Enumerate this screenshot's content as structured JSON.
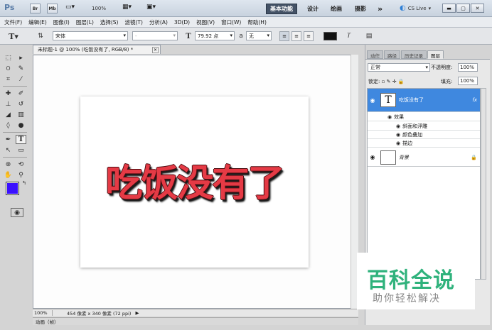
{
  "app": {
    "logo": "Ps",
    "br_label": "Br",
    "mb_label": "Mb"
  },
  "titlebar": {
    "zoom": "100%",
    "workspaces": [
      "基本功能",
      "设计",
      "绘画",
      "摄影"
    ],
    "more": "»",
    "cslive": "CS Live"
  },
  "menu": [
    "文件(F)",
    "编辑(E)",
    "图像(I)",
    "图层(L)",
    "选择(S)",
    "滤镜(T)",
    "分析(A)",
    "3D(D)",
    "视图(V)",
    "窗口(W)",
    "帮助(H)"
  ],
  "options": {
    "font_family": "宋体",
    "font_style": "-",
    "font_size": "79.92 点",
    "aa_label": "a",
    "aa_value": "无"
  },
  "document": {
    "tab_title": "未标题-1 @ 100% (吃饭没有了, RGB/8) *",
    "canvas_text": "吃饭没有了",
    "status_zoom": "100%",
    "status_info": "454 像素 x 340 像素 (72 ppi)",
    "timeline": "动画（帧）"
  },
  "panel": {
    "tabs": [
      "动作",
      "路径",
      "历史记录",
      "图层"
    ],
    "blend_mode": "正常",
    "opacity_label": "不透明度:",
    "opacity": "100%",
    "lock_label": "锁定:",
    "fill_label": "填充:",
    "fill": "100%",
    "layers": [
      {
        "name": "吃饭没有了",
        "fx": "fx"
      },
      {
        "name": "背景"
      }
    ],
    "effects_label": "效果",
    "effects": [
      "斜面和浮雕",
      "颜色叠加",
      "描边"
    ]
  },
  "colors": {
    "foreground": "#3a10ff",
    "background": "#000000",
    "accent": "#3f88df",
    "canvas_text": "#e53a45"
  },
  "watermark": {
    "logo": "百科全说",
    "sub": "助你轻松解决"
  }
}
